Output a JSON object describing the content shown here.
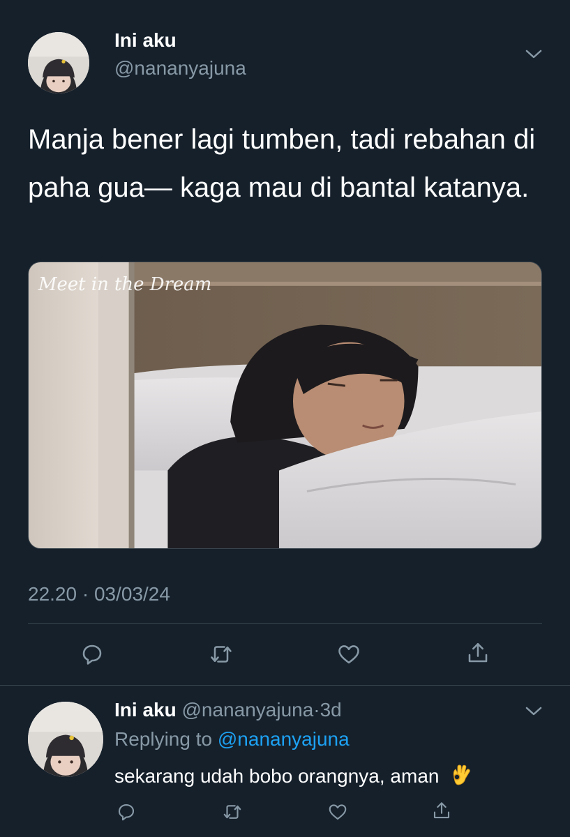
{
  "tweet": {
    "author_name": "Ini aku",
    "author_handle": "@nananyajuna",
    "text": "Manja bener lagi tumben, tadi rebahan di paha gua— kaga mau di bantal katanya.",
    "photo_watermark": "Meet in the Dream",
    "timestamp": "22.20 · 03/03/24",
    "actions": [
      "reply-icon",
      "retweet-icon",
      "like-icon",
      "share-icon"
    ]
  },
  "reply": {
    "author_name": "Ini aku",
    "author_handle": "@nananyajuna",
    "dot": "·",
    "time": "3d",
    "replying_prefix": "Replying to",
    "replying_to": "@nananyajuna",
    "text": "sekarang udah bobo orangnya, aman",
    "emoji": "ok-hand-emoji"
  },
  "colors": {
    "background": "#15202b",
    "secondary_text": "#8899a6",
    "link": "#1da1f2",
    "divider": "#38444d"
  }
}
